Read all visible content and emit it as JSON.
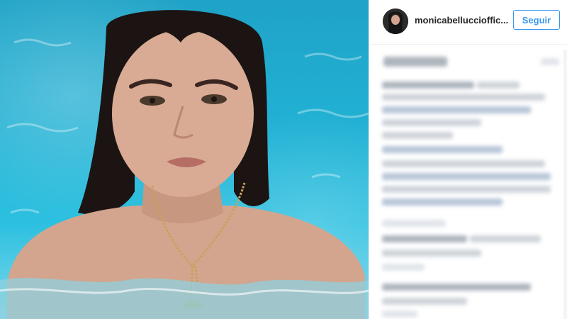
{
  "post": {
    "username": "monicabelluccioffic...",
    "follow_label": "Seguir"
  },
  "icons": {
    "avatar": "profile-avatar",
    "scrollbar": "scrollbar"
  },
  "colors": {
    "accent": "#3897f0",
    "username": "#262626",
    "pool": "#21b1d4"
  }
}
